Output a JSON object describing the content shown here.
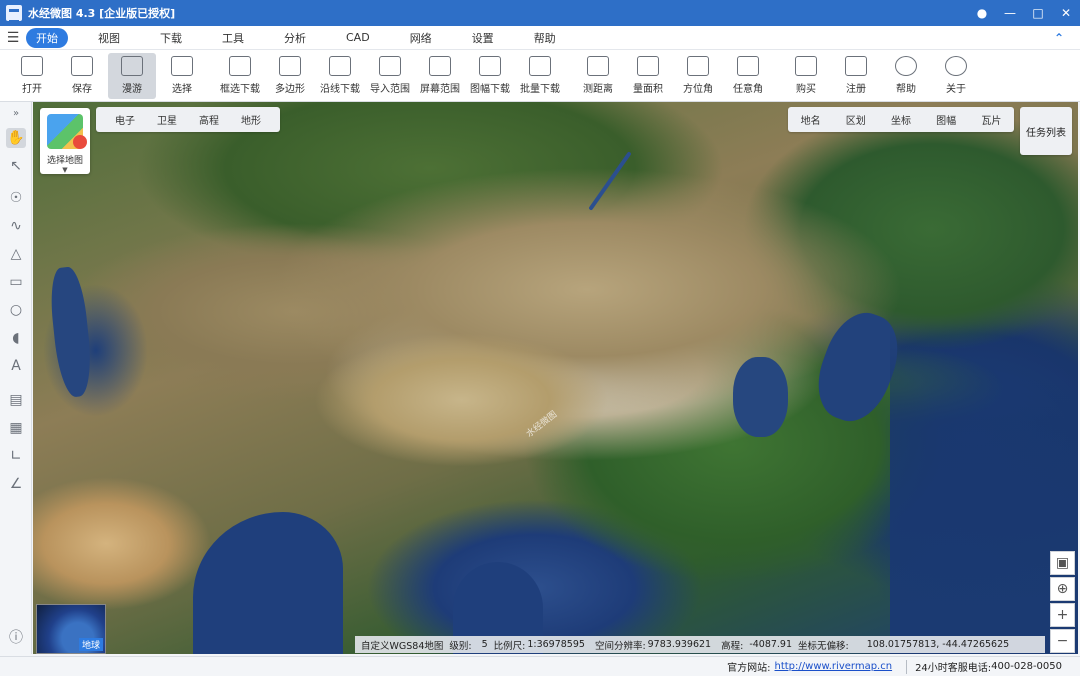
{
  "window": {
    "title": "水经微图 4.3 [企业版已授权]"
  },
  "menu": {
    "items": [
      "开始",
      "视图",
      "下载",
      "工具",
      "分析",
      "CAD",
      "网络",
      "设置",
      "帮助"
    ],
    "active_index": 0
  },
  "toolbar": {
    "tools": [
      {
        "label": "打开",
        "icon": "folder-icon",
        "dropdown": true
      },
      {
        "label": "保存",
        "icon": "save-icon"
      },
      {
        "label": "漫游",
        "icon": "hand-icon",
        "active": true
      },
      {
        "label": "选择",
        "icon": "pointer-icon"
      },
      {
        "label": "框选下载",
        "icon": "box-download-icon"
      },
      {
        "label": "多边形",
        "icon": "polygon-icon"
      },
      {
        "label": "沿线下载",
        "icon": "line-download-icon"
      },
      {
        "label": "导入范围",
        "icon": "import-range-icon"
      },
      {
        "label": "屏幕范围",
        "icon": "screen-range-icon"
      },
      {
        "label": "图幅下载",
        "icon": "sheet-download-icon",
        "dropdown": true
      },
      {
        "label": "批量下载",
        "icon": "batch-download-icon"
      },
      {
        "label": "测距离",
        "icon": "ruler-icon"
      },
      {
        "label": "量面积",
        "icon": "area-icon"
      },
      {
        "label": "方位角",
        "icon": "azimuth-icon"
      },
      {
        "label": "任意角",
        "icon": "angle-icon"
      },
      {
        "label": "购买",
        "icon": "cart-icon"
      },
      {
        "label": "注册",
        "icon": "lock-icon"
      },
      {
        "label": "帮助",
        "icon": "help-icon"
      },
      {
        "label": "关于",
        "icon": "info-icon"
      }
    ]
  },
  "map": {
    "select_map_label": "选择地图",
    "layer_tabs": [
      "电子",
      "卫星",
      "高程",
      "地形"
    ],
    "overlay_tabs": [
      "地名",
      "区划",
      "坐标",
      "图幅",
      "瓦片"
    ],
    "task_list_label": "任务列表",
    "minimap_label": "地球",
    "watermark": "水经微图"
  },
  "status": {
    "crs": "自定义WGS84地图",
    "level_label": "级别:",
    "level": "5",
    "scale_label": "比例尺:",
    "scale": "1:36978595",
    "resolution_label": "空间分辨率:",
    "resolution": "9783.939621",
    "elevation_label": "高程:",
    "elevation": "-4087.91",
    "offset_label": "坐标无偏移:",
    "coords": "108.01757813, -44.47265625"
  },
  "footer": {
    "site_label": "官方网站:",
    "site_url": "http://www.rivermap.cn",
    "service_label": "24小时客服电话:",
    "phone": "400-028-0050"
  },
  "colors": {
    "titlebar": "#2e6fc7",
    "accent": "#2e7be0"
  }
}
